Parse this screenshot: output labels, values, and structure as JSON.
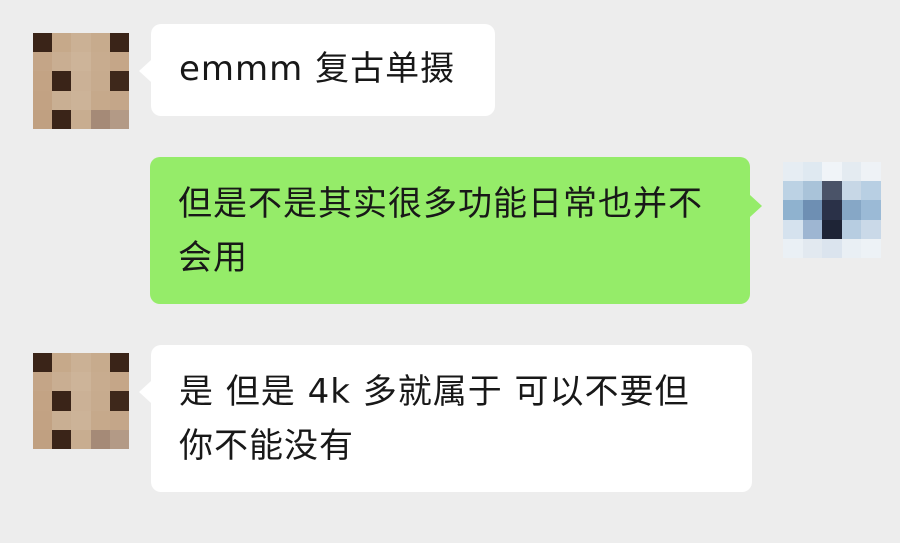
{
  "chat": {
    "messages": [
      {
        "side": "left",
        "text": "emmm 复古单摄"
      },
      {
        "side": "right",
        "text": "但是不是其实很多功能日常也并不会用"
      },
      {
        "side": "left",
        "text": "是 但是 4k 多就属于 可以不要但你不能没有"
      }
    ]
  },
  "avatars": {
    "friend": {
      "type": "pixelated",
      "palette": [
        "#3a2418",
        "#c6a98a",
        "#cbb195",
        "#c7ab8d",
        "#3a2418",
        "#c4a587",
        "#c9ae92",
        "#cdb499",
        "#c8ac8f",
        "#c5a688",
        "#c3a384",
        "#3a2418",
        "#cbb196",
        "#c7ab8e",
        "#3e281b",
        "#c2a283",
        "#c9af93",
        "#ccb398",
        "#c6a98b",
        "#c4a689",
        "#c0a081",
        "#3a2418",
        "#c8ad90",
        "#a58a77",
        "#b39a86"
      ]
    },
    "me": {
      "type": "pixelated",
      "palette": [
        "#e6edf3",
        "#dfe9f1",
        "#f0f4f8",
        "#e4ebf1",
        "#eef2f6",
        "#bcd2e4",
        "#a9c3d9",
        "#4a5368",
        "#c7d7e6",
        "#b8cfe3",
        "#8fb2cf",
        "#6e8fb3",
        "#2a3148",
        "#86a7c6",
        "#9bbad6",
        "#d5e2ee",
        "#9eb6d2",
        "#1e2436",
        "#b7cde1",
        "#cad9e8",
        "#eaf0f5",
        "#e2e9f0",
        "#dbe4ee",
        "#e9eff4",
        "#edf2f6"
      ]
    }
  }
}
